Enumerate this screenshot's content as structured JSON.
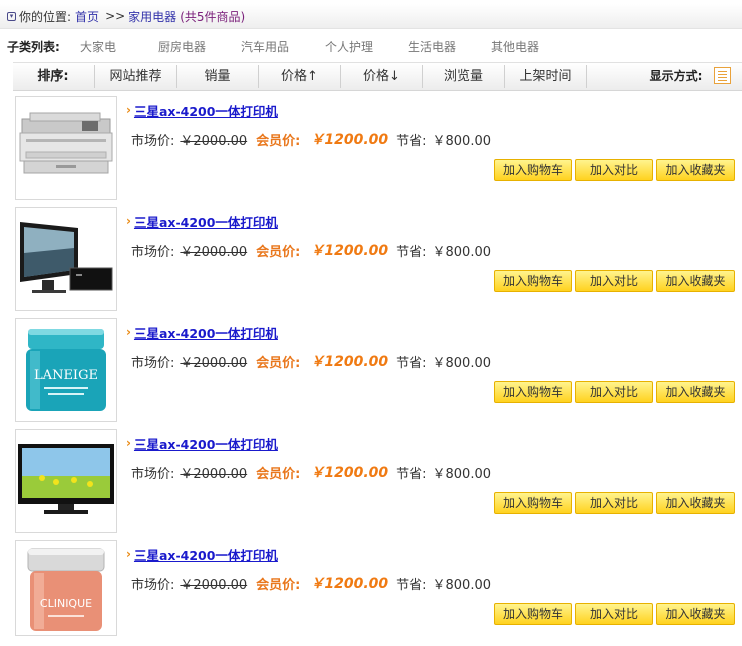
{
  "breadcrumb": {
    "prefix": "你的位置:",
    "home": "首页",
    "separator": ">>",
    "category": "家用电器",
    "count": "(共5件商品)"
  },
  "subcategories": {
    "label": "子类列表:",
    "items": [
      "大家电",
      "厨房电器",
      "汽车用品",
      "个人护理",
      "生活电器",
      "其他电器"
    ]
  },
  "sortbar": {
    "label": "排序:",
    "options": [
      "网站推荐",
      "销量",
      "价格↑",
      "价格↓",
      "浏览量",
      "上架时间"
    ],
    "display_label": "显示方式:",
    "display_icon": "list-view-icon"
  },
  "products": [
    {
      "title": "三星ax-4200一体打印机",
      "market_label": "市场价:",
      "market_price": "￥2000.00",
      "vip_label": "会员价:",
      "vip_price": "￥1200.00",
      "save_label": "节省:",
      "save_amount": "￥800.00",
      "image": "laser-printer",
      "buttons": {
        "cart": "加入购物车",
        "compare": "加入对比",
        "favorite": "加入收藏夹"
      }
    },
    {
      "title": "三星ax-4200一体打印机",
      "market_label": "市场价:",
      "market_price": "￥2000.00",
      "vip_label": "会员价:",
      "vip_price": "￥1200.00",
      "save_label": "节省:",
      "save_amount": "￥800.00",
      "image": "desktop-computer",
      "buttons": {
        "cart": "加入购物车",
        "compare": "加入对比",
        "favorite": "加入收藏夹"
      }
    },
    {
      "title": "三星ax-4200一体打印机",
      "market_label": "市场价:",
      "market_price": "￥2000.00",
      "vip_label": "会员价:",
      "vip_price": "￥1200.00",
      "save_label": "节省:",
      "save_amount": "￥800.00",
      "image": "laneige-cream-jar",
      "buttons": {
        "cart": "加入购物车",
        "compare": "加入对比",
        "favorite": "加入收藏夹"
      }
    },
    {
      "title": "三星ax-4200一体打印机",
      "market_label": "市场价:",
      "market_price": "￥2000.00",
      "vip_label": "会员价:",
      "vip_price": "￥1200.00",
      "save_label": "节省:",
      "save_amount": "￥800.00",
      "image": "lcd-tv",
      "buttons": {
        "cart": "加入购物车",
        "compare": "加入对比",
        "favorite": "加入收藏夹"
      }
    },
    {
      "title": "三星ax-4200一体打印机",
      "market_label": "市场价:",
      "market_price": "￥2000.00",
      "vip_label": "会员价:",
      "vip_price": "￥1200.00",
      "save_label": "节省:",
      "save_amount": "￥800.00",
      "image": "clinique-cream-jar",
      "buttons": {
        "cart": "加入购物车",
        "compare": "加入对比",
        "favorite": "加入收藏夹"
      }
    }
  ],
  "images": {
    "laneige_brand": "LANEIGE",
    "clinique_brand": "CLINIQUE"
  }
}
